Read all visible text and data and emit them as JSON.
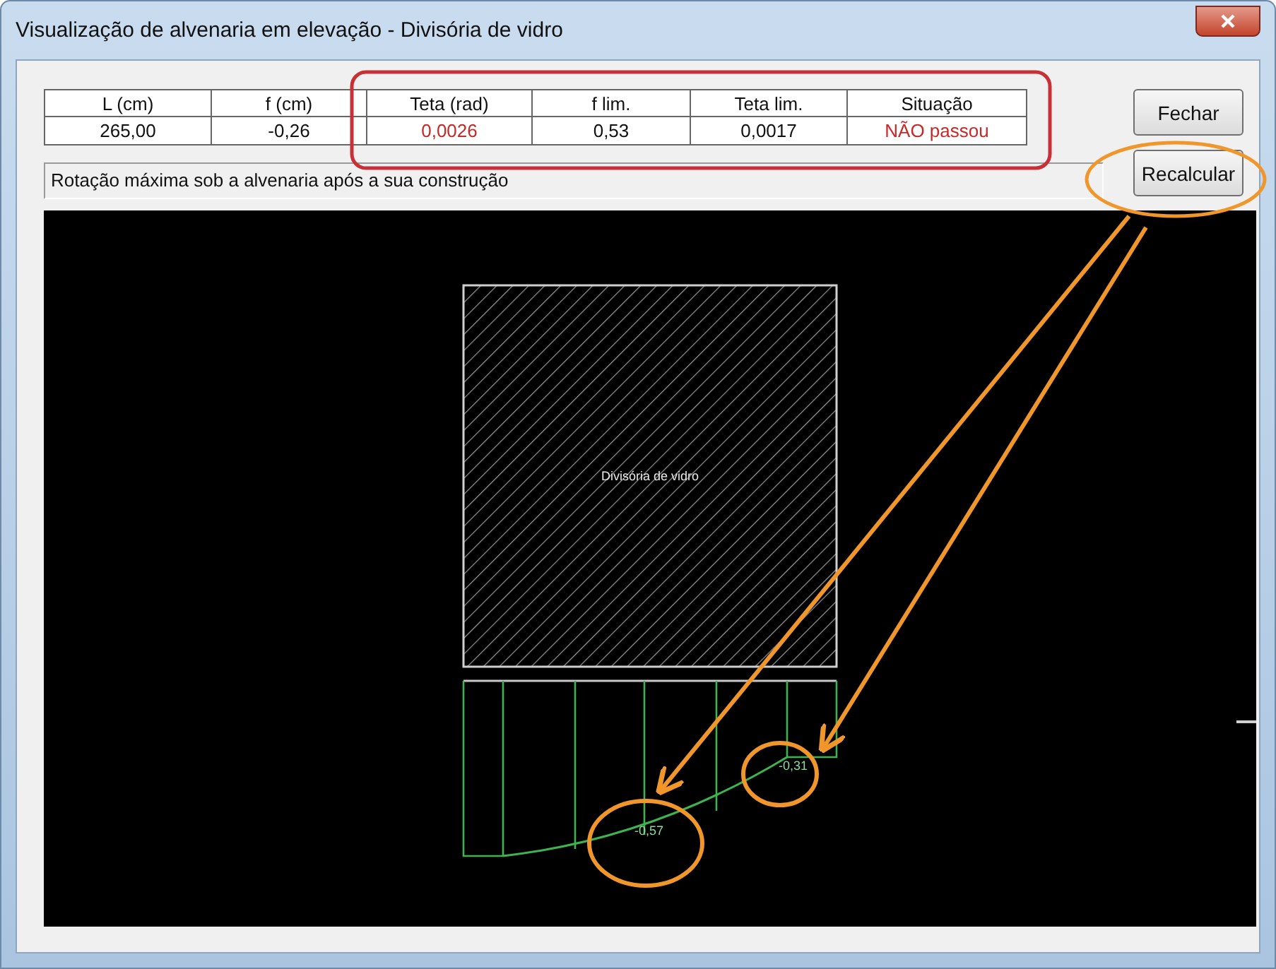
{
  "window": {
    "title": "Visualização de alvenaria em elevação - Divisória de vidro"
  },
  "table": {
    "columns": [
      "L (cm)",
      "f (cm)",
      "Teta (rad)",
      "f lim.",
      "Teta lim.",
      "Situação"
    ],
    "rows": [
      {
        "cells": [
          {
            "text": "265,00",
            "alert": false
          },
          {
            "text": "-0,26",
            "alert": false
          },
          {
            "text": "0,0026",
            "alert": true
          },
          {
            "text": "0,53",
            "alert": false
          },
          {
            "text": "0,0017",
            "alert": false
          },
          {
            "text": "NÃO passou",
            "alert": true
          }
        ]
      }
    ]
  },
  "buttons": [
    "Fechar",
    "Recalcular"
  ],
  "status_text": "Rotação máxima sob a alvenaria após a sua construção",
  "drawing": {
    "wall_label": "Divisória de vidro",
    "deflection_labels": [
      "-0,57",
      "-0,31"
    ]
  }
}
